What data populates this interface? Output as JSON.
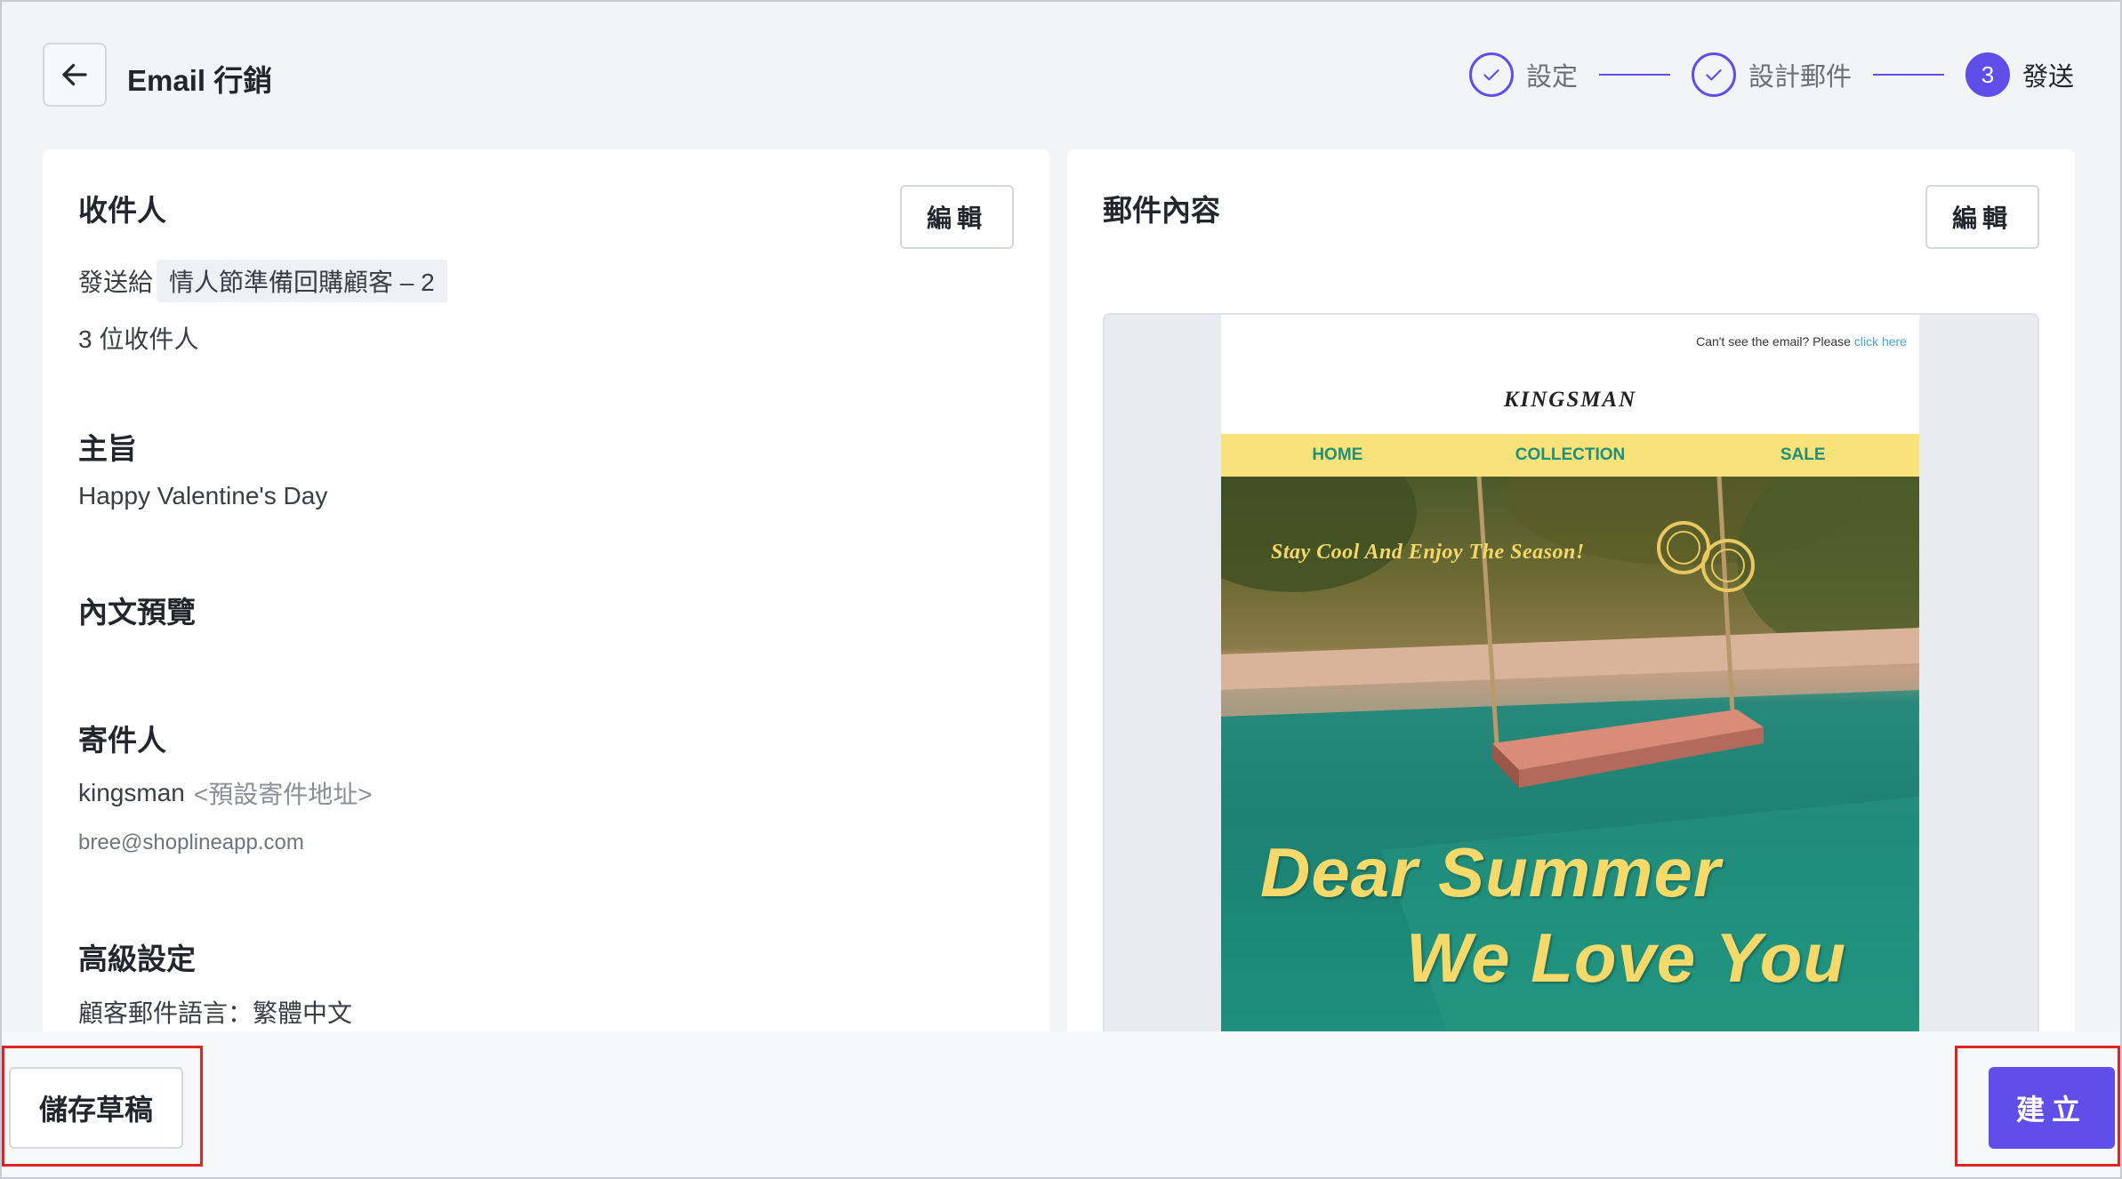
{
  "header": {
    "title": "Email 行銷",
    "steps": [
      {
        "label": "設定",
        "state": "done"
      },
      {
        "label": "設計郵件",
        "state": "done"
      },
      {
        "label": "發送",
        "state": "active",
        "number": "3"
      }
    ]
  },
  "left_card": {
    "edit_label": "編輯",
    "recipients": {
      "title": "收件人",
      "send_to_label": "發送給",
      "segment": "情人節準備回購顧客 – 2",
      "count": "3 位收件人"
    },
    "subject": {
      "title": "主旨",
      "value": "Happy Valentine's Day"
    },
    "preview_text": {
      "title": "內文預覽"
    },
    "sender": {
      "title": "寄件人",
      "name": "kingsman",
      "address_label": "<預設寄件地址>",
      "email": "bree@shoplineapp.com"
    },
    "advanced": {
      "title": "高級設定",
      "language_label": "顧客郵件語言：",
      "language_value": "繁體中文"
    }
  },
  "right_card": {
    "title": "郵件內容",
    "edit_label": "編輯",
    "email_preview": {
      "top_text": "Can't see the email? Please",
      "top_link": "click here",
      "brand": "KINGSMAN",
      "nav": [
        "HOME",
        "COLLECTION",
        "SALE"
      ],
      "tagline": "Stay Cool And Enjoy The Season!",
      "headline_1": "Dear Summer",
      "headline_2": "We Love You"
    }
  },
  "footer": {
    "save_draft_label": "儲存草稿",
    "create_label": "建立"
  },
  "colors": {
    "accent": "#5f4ee8",
    "highlight": "#e02424",
    "nav_bg": "#f9e27a",
    "nav_text": "#1f8f7a"
  }
}
